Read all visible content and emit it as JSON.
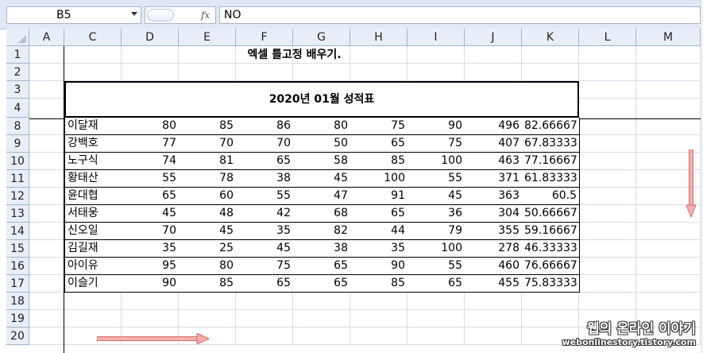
{
  "formula_bar": {
    "name_box": "B5",
    "fx_label": "fx",
    "value": "NO"
  },
  "columns": [
    "A",
    "C",
    "D",
    "E",
    "F",
    "G",
    "H",
    "I",
    "J",
    "K",
    "L",
    "M"
  ],
  "rows": [
    "1",
    "2",
    "3",
    "4",
    "8",
    "9",
    "10",
    "11",
    "12",
    "13",
    "14",
    "15",
    "16",
    "17",
    "18",
    "19",
    "20"
  ],
  "sheet": {
    "title": "엑셀 틀고정 배우기.",
    "table_title": "2020년 01월 성적표",
    "records": [
      [
        "이달재",
        "80",
        "85",
        "86",
        "80",
        "75",
        "90",
        "496",
        "82.66667"
      ],
      [
        "강백호",
        "77",
        "70",
        "70",
        "50",
        "65",
        "75",
        "407",
        "67.83333"
      ],
      [
        "노구식",
        "74",
        "81",
        "65",
        "58",
        "85",
        "100",
        "463",
        "77.16667"
      ],
      [
        "황태산",
        "55",
        "78",
        "38",
        "45",
        "100",
        "55",
        "371",
        "61.83333"
      ],
      [
        "윤대협",
        "65",
        "60",
        "55",
        "47",
        "91",
        "45",
        "363",
        "60.5"
      ],
      [
        "서태웅",
        "45",
        "48",
        "42",
        "68",
        "65",
        "36",
        "304",
        "50.66667"
      ],
      [
        "신오일",
        "70",
        "45",
        "35",
        "82",
        "44",
        "79",
        "355",
        "59.16667"
      ],
      [
        "김길재",
        "35",
        "25",
        "45",
        "38",
        "35",
        "100",
        "278",
        "46.33333"
      ],
      [
        "아이유",
        "95",
        "80",
        "75",
        "65",
        "90",
        "55",
        "460",
        "76.66667"
      ],
      [
        "이슬기",
        "90",
        "85",
        "65",
        "65",
        "85",
        "65",
        "455",
        "75.83333"
      ]
    ]
  },
  "watermark": {
    "line1": "웹의 온라인 이야기",
    "line2": "webonlinestory.tistory.com"
  },
  "colors": {
    "header_bg": "#e8eef7",
    "grid": "#d8dde5",
    "arrow": "#e88080"
  }
}
